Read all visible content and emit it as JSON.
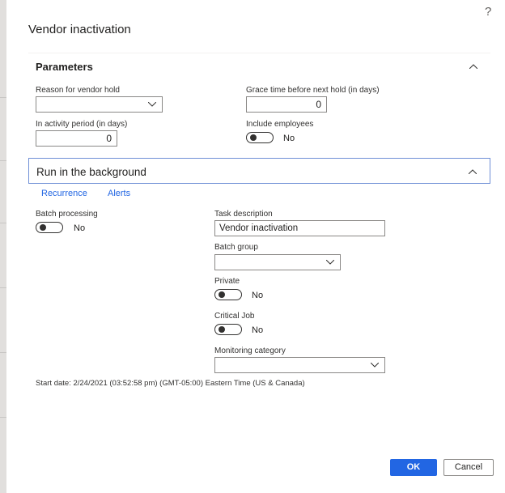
{
  "dialog": {
    "title": "Vendor inactivation",
    "help_icon": "?"
  },
  "parameters": {
    "header": "Parameters",
    "reason_label": "Reason for vendor hold",
    "reason_value": "",
    "grace_label": "Grace time before next hold (in days)",
    "grace_value": "0",
    "inactivity_label": "In activity period (in days)",
    "inactivity_value": "0",
    "include_employees_label": "Include employees",
    "include_employees_value": "No"
  },
  "background": {
    "header": "Run in the background",
    "tabs": [
      "Recurrence",
      "Alerts"
    ],
    "batch_processing_label": "Batch processing",
    "batch_processing_value": "No",
    "task_description_label": "Task description",
    "task_description_value": "Vendor inactivation",
    "batch_group_label": "Batch group",
    "batch_group_value": "",
    "private_label": "Private",
    "private_value": "No",
    "critical_job_label": "Critical Job",
    "critical_job_value": "No",
    "monitoring_category_label": "Monitoring category",
    "monitoring_category_value": "",
    "start_date": "Start date: 2/24/2021 (03:52:58 pm) (GMT-05:00) Eastern Time (US & Canada)"
  },
  "buttons": {
    "ok": "OK",
    "cancel": "Cancel"
  },
  "icons": {
    "help": "help-icon",
    "collapse": "chevron-up-icon",
    "dropdown": "chevron-down-icon"
  },
  "colors": {
    "accent": "#2266e3",
    "focus_border": "#6f8fd6"
  }
}
